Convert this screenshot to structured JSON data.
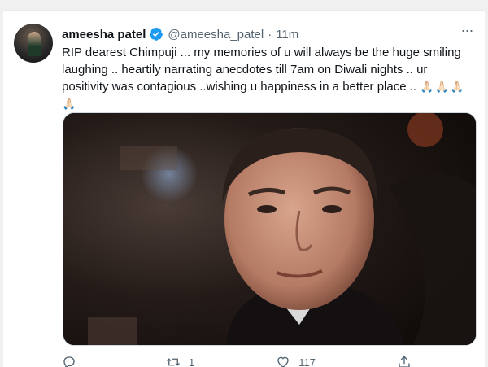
{
  "tweet": {
    "display_name": "ameesha patel",
    "handle": "@ameesha_patel",
    "separator": "·",
    "time": "11m",
    "more_icon": "more-horizontal-icon",
    "verified_icon": "verified-badge-icon",
    "text_line1": "RIP dearest Chimpuji ... my memories of u will always be the huge smiling",
    "text_line2": "laughing .. heartily narrating anecdotes till 7am on Diwali nights .. ur",
    "text_line3": "positivity was contagious ..wishing u happiness in a better place ..",
    "emoji_inline": "🙏🏻🙏🏻🙏🏻",
    "emoji_trailing": "🙏🏻",
    "accent_color": "#1d9bf0"
  },
  "actions": {
    "reply_icon": "reply-icon",
    "reply_count": "",
    "retweet_icon": "retweet-icon",
    "retweet_count": "1",
    "like_icon": "heart-icon",
    "like_count": "117",
    "share_icon": "share-icon"
  }
}
